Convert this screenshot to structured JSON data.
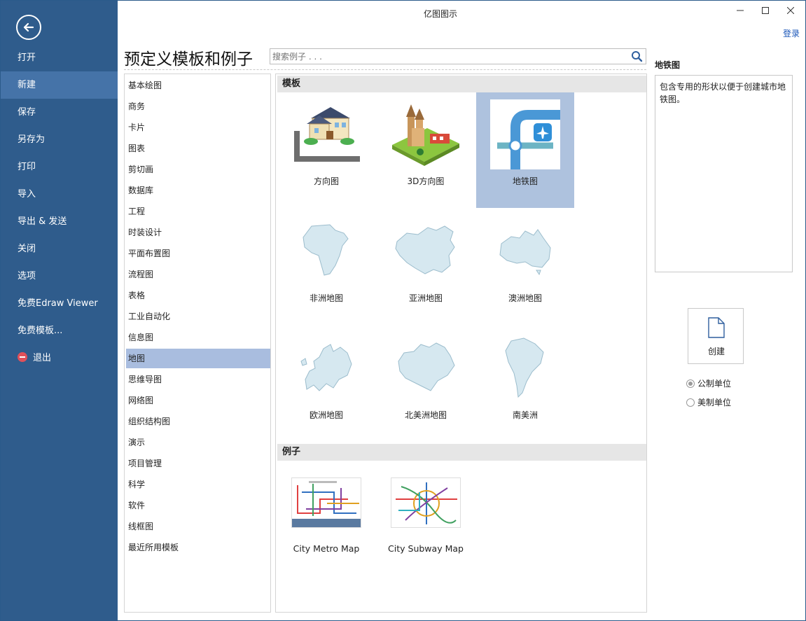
{
  "window": {
    "title": "亿图图示",
    "login": "登录"
  },
  "sidebar": {
    "items": [
      {
        "label": "打开"
      },
      {
        "label": "新建",
        "active": true
      },
      {
        "label": "保存"
      },
      {
        "label": "另存为"
      },
      {
        "label": "打印"
      },
      {
        "label": "导入"
      },
      {
        "label": "导出 & 发送"
      },
      {
        "label": "关闭"
      },
      {
        "label": "选项"
      },
      {
        "label": "免费Edraw Viewer"
      },
      {
        "label": "免费模板..."
      },
      {
        "label": "退出"
      }
    ]
  },
  "main": {
    "title": "预定义模板和例子",
    "search_placeholder": "搜索例子 . . ."
  },
  "categories": [
    "基本绘图",
    "商务",
    "卡片",
    "图表",
    "剪切画",
    "数据库",
    "工程",
    "时装设计",
    "平面布置图",
    "流程图",
    "表格",
    "工业自动化",
    "信息图",
    "地图",
    "思维导图",
    "网络图",
    "组织结构图",
    "演示",
    "项目管理",
    "科学",
    "软件",
    "线框图",
    "最近所用模板"
  ],
  "active_category": "地图",
  "templates": {
    "header": "模板",
    "items": [
      "方向图",
      "3D方向图",
      "地铁图",
      "非洲地图",
      "亚洲地图",
      "澳洲地图",
      "欧洲地图",
      "北美洲地图",
      "南美洲"
    ],
    "selected": "地铁图"
  },
  "examples": {
    "header": "例子",
    "items": [
      "City Metro Map",
      "City Subway Map"
    ]
  },
  "detail": {
    "title": "地铁图",
    "description": "包含专用的形状以便于创建城市地铁图。"
  },
  "create_button": "创建",
  "units": {
    "metric": "公制单位",
    "us": "美制单位",
    "selected": "metric"
  },
  "colors": {
    "sidebar_bg": "#2f5c8c",
    "sidebar_active": "#4573a8",
    "selection": "#aec2de",
    "link": "#1a56b8"
  }
}
